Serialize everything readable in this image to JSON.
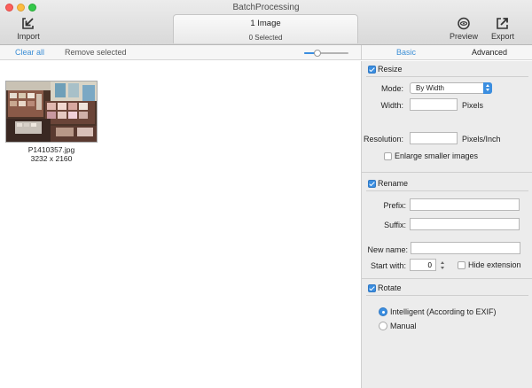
{
  "window": {
    "title": "BatchProcessing"
  },
  "toolbar": {
    "import_label": "Import",
    "preview_label": "Preview",
    "export_label": "Export",
    "status_count": "1 Image",
    "status_selected": "0 Selected"
  },
  "subbar": {
    "clear_all": "Clear all",
    "remove_selected": "Remove selected",
    "thumb_size_level": 0.3
  },
  "tabs": {
    "basic": "Basic",
    "advanced": "Advanced",
    "active": "Basic"
  },
  "images": [
    {
      "name": "P1410357.jpg",
      "dimensions": "3232 x 2160"
    }
  ],
  "resize": {
    "label": "Resize",
    "checked": true,
    "mode_label": "Mode:",
    "mode_value": "By Width",
    "width_label": "Width:",
    "width_value": "",
    "width_unit": "Pixels",
    "resolution_label": "Resolution:",
    "resolution_value": "",
    "resolution_unit": "Pixels/Inch",
    "enlarge_label": "Enlarge smaller images",
    "enlarge_checked": false
  },
  "rename": {
    "label": "Rename",
    "checked": true,
    "prefix_label": "Prefix:",
    "prefix_value": "",
    "suffix_label": "Suffix:",
    "suffix_value": "",
    "newname_label": "New name:",
    "newname_value": "",
    "startwith_label": "Start with:",
    "startwith_value": "0",
    "hide_ext_label": "Hide extension",
    "hide_ext_checked": false
  },
  "rotate": {
    "label": "Rotate",
    "checked": true,
    "option_intelligent": "Intelligent (According to EXIF)",
    "option_manual": "Manual",
    "selected": "intelligent"
  },
  "colors": {
    "accent": "#3b8ee0",
    "link": "#3c8fd6"
  }
}
